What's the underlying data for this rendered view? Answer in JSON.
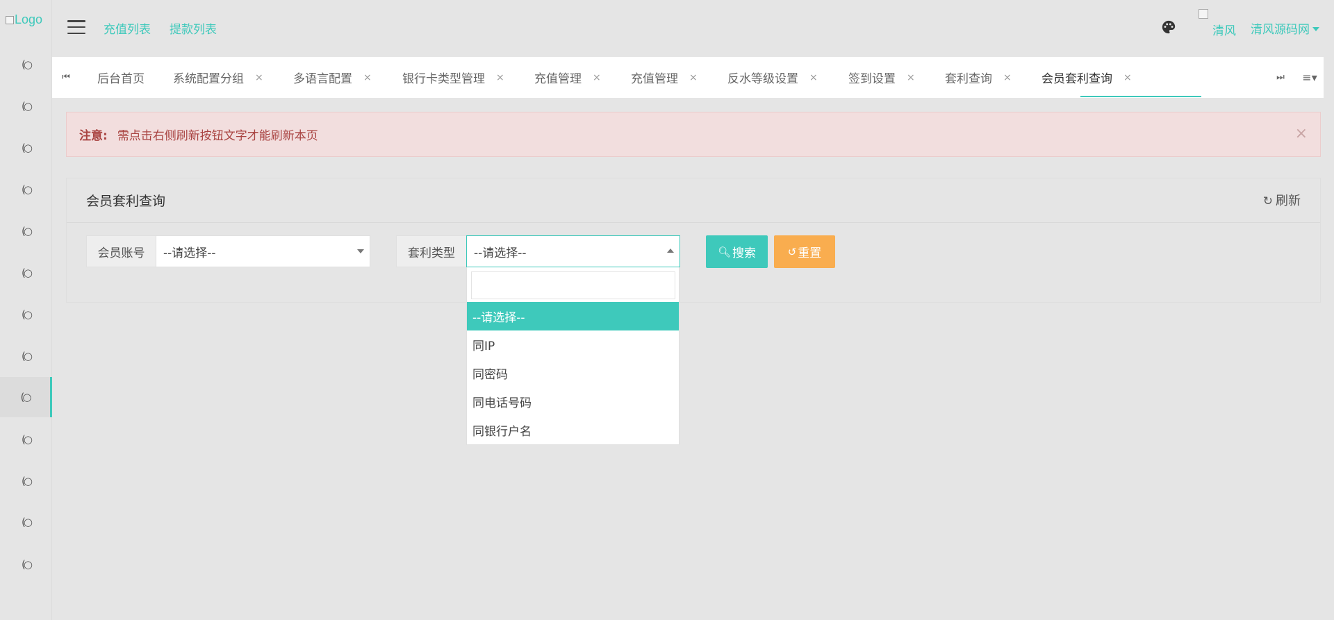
{
  "logo": {
    "alt": "Logo"
  },
  "sidebar": {
    "items": [
      {
        "icon": "(○"
      },
      {
        "icon": "(○"
      },
      {
        "icon": "(○"
      },
      {
        "icon": "(○"
      },
      {
        "icon": "(○"
      },
      {
        "icon": "(○"
      },
      {
        "icon": "(○"
      },
      {
        "icon": "(○"
      },
      {
        "icon": "(○"
      },
      {
        "icon": "(○"
      },
      {
        "icon": "(○"
      },
      {
        "icon": "(○"
      },
      {
        "icon": "(○"
      }
    ],
    "active_index": 8
  },
  "header": {
    "links": [
      "充值列表",
      "提款列表"
    ],
    "avatar_alt": "清风",
    "user_name": "清风源码网"
  },
  "tabs": {
    "prev_icon": "⏮",
    "next_icon": "⏭",
    "menu_icon": "≡▾",
    "items": [
      {
        "label": "后台首页",
        "closable": false
      },
      {
        "label": "系统配置分组",
        "closable": true
      },
      {
        "label": "多语言配置",
        "closable": true
      },
      {
        "label": "银行卡类型管理",
        "closable": true
      },
      {
        "label": "充值管理",
        "closable": true
      },
      {
        "label": "充值管理",
        "closable": true
      },
      {
        "label": "反水等级设置",
        "closable": true
      },
      {
        "label": "签到设置",
        "closable": true
      },
      {
        "label": "套利查询",
        "closable": true
      },
      {
        "label": "会员套利查询",
        "closable": true,
        "active": true
      }
    ],
    "close_glyph": "×"
  },
  "alert": {
    "label": "注意:",
    "message": "需点击右侧刷新按钮文字才能刷新本页",
    "close_glyph": "×"
  },
  "panel": {
    "title": "会员套利查询",
    "refresh_label": "刷新"
  },
  "filters": {
    "member_label": "会员账号",
    "member_value": "--请选择--",
    "type_label": "套利类型",
    "type_value": "--请选择--",
    "search_label": "搜索",
    "reset_label": "重置"
  },
  "dropdown": {
    "search_value": "",
    "options": [
      "--请选择--",
      "同IP",
      "同密码",
      "同电话号码",
      "同银行户名"
    ],
    "selected_index": 0
  },
  "colors": {
    "accent": "#3ec9bb",
    "warning": "#f9ad4f",
    "alert_bg": "#f2dede",
    "alert_text": "#a94442"
  }
}
